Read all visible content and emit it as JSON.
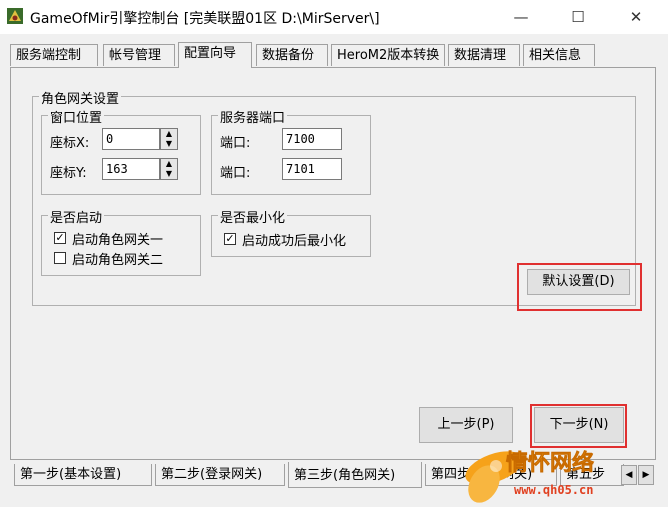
{
  "window": {
    "title": "GameOfMir引擎控制台 [完美联盟01区 D:\\MirServer\\]",
    "min_glyph": "—",
    "max_glyph": "☐",
    "close_glyph": "✕"
  },
  "tabs": [
    "服务端控制",
    "帐号管理",
    "配置向导",
    "数据备份",
    "HeroM2版本转换",
    "数据清理",
    "相关信息"
  ],
  "active_tab": "配置向导",
  "role_gateway": {
    "group_title": "角色网关设置",
    "window_pos": {
      "title": "窗口位置",
      "x_label": "座标X:",
      "x_value": "0",
      "y_label": "座标Y:",
      "y_value": "163"
    },
    "server_port": {
      "title": "服务器端口",
      "port1_label": "端口:",
      "port1_value": "7100",
      "port2_label": "端口:",
      "port2_value": "7101"
    },
    "start_enabled": {
      "title": "是否启动",
      "gw1_label": "启动角色网关一",
      "gw1_checked": true,
      "gw2_label": "启动角色网关二",
      "gw2_checked": false
    },
    "minimize": {
      "title": "是否最小化",
      "label": "启动成功后最小化",
      "checked": true
    },
    "default_button": "默认设置(D)"
  },
  "nav": {
    "prev_button": "上一步(P)",
    "next_button": "下一步(N)"
  },
  "steps": [
    "第一步(基本设置)",
    "第二步(登录网关)",
    "第三步(角色网关)",
    "第四步(游戏网关)",
    "第五步"
  ],
  "active_step": "第三步(角色网关)",
  "watermark": {
    "text": "情怀网络",
    "url": "www.qh05.cn"
  },
  "colors": {
    "highlight_box": "#e03030",
    "watermark": "#f6a21a"
  }
}
